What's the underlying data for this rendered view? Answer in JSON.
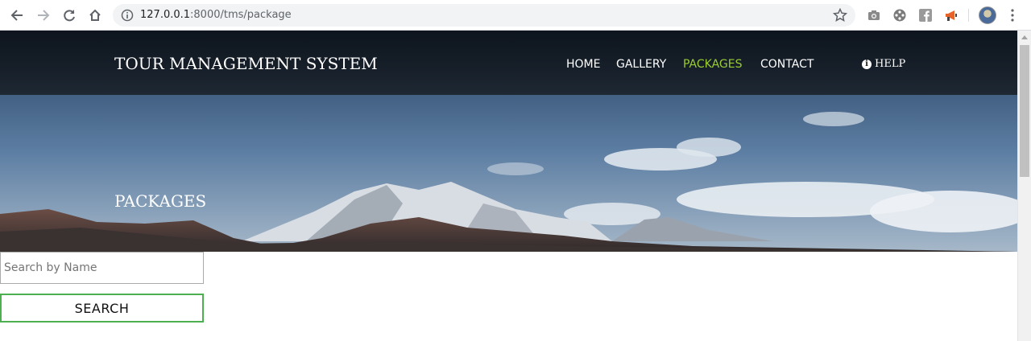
{
  "browser": {
    "url_host": "127.0.0.1",
    "url_path": ":8000/tms/package"
  },
  "site": {
    "brand": "TOUR MANAGEMENT SYSTEM",
    "nav": [
      {
        "label": "HOME",
        "active": false
      },
      {
        "label": "GALLERY",
        "active": false
      },
      {
        "label": "PACKAGES",
        "active": true
      },
      {
        "label": "CONTACT",
        "active": false
      }
    ],
    "help_label": "HELP",
    "accent_color": "#9acd32"
  },
  "hero": {
    "title": "PACKAGES"
  },
  "search": {
    "placeholder": "Search by Name",
    "value": "",
    "button_label": "SEARCH",
    "border_color": "#4caf50"
  }
}
